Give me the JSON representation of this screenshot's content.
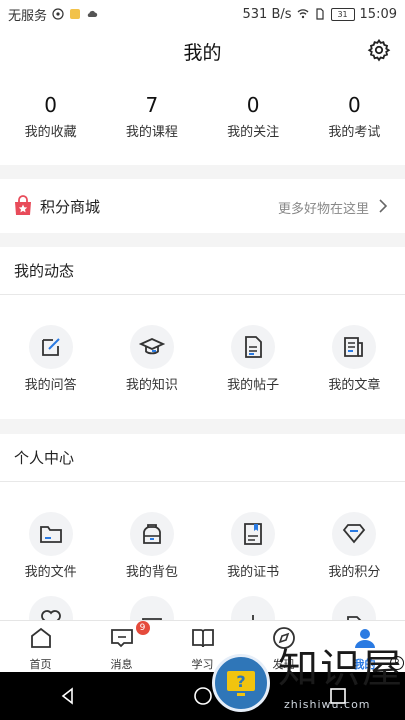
{
  "status": {
    "carrier": "无服务",
    "speed": "531 B/s",
    "battery": "31",
    "time": "15:09"
  },
  "header": {
    "title": "我的"
  },
  "stats": [
    {
      "value": "0",
      "label": "我的收藏"
    },
    {
      "value": "7",
      "label": "我的课程"
    },
    {
      "value": "0",
      "label": "我的关注"
    },
    {
      "value": "0",
      "label": "我的考试"
    }
  ],
  "mall": {
    "title": "积分商城",
    "more": "更多好物在这里"
  },
  "activity": {
    "title": "我的动态",
    "items": [
      {
        "label": "我的问答",
        "icon": "edit-icon"
      },
      {
        "label": "我的知识",
        "icon": "graduation-cap-icon"
      },
      {
        "label": "我的帖子",
        "icon": "document-icon"
      },
      {
        "label": "我的文章",
        "icon": "article-icon"
      }
    ]
  },
  "personal": {
    "title": "个人中心",
    "items": [
      {
        "label": "我的文件",
        "icon": "folder-icon"
      },
      {
        "label": "我的背包",
        "icon": "backpack-icon"
      },
      {
        "label": "我的证书",
        "icon": "certificate-icon"
      },
      {
        "label": "我的积分",
        "icon": "diamond-icon"
      }
    ]
  },
  "tabs": [
    {
      "label": "首页",
      "icon": "home-icon"
    },
    {
      "label": "消息",
      "icon": "message-icon",
      "badge": "9"
    },
    {
      "label": "学习",
      "icon": "book-icon"
    },
    {
      "label": "发现",
      "icon": "compass-icon"
    },
    {
      "label": "我的",
      "icon": "user-icon",
      "active": true
    }
  ],
  "watermark": {
    "brand": "知识屋",
    "site": "zhishiwu.com",
    "reg": "R"
  },
  "colors": {
    "accent": "#2a7ae2",
    "badge": "#e54b3c",
    "mall_icon": "#e84b5a"
  }
}
